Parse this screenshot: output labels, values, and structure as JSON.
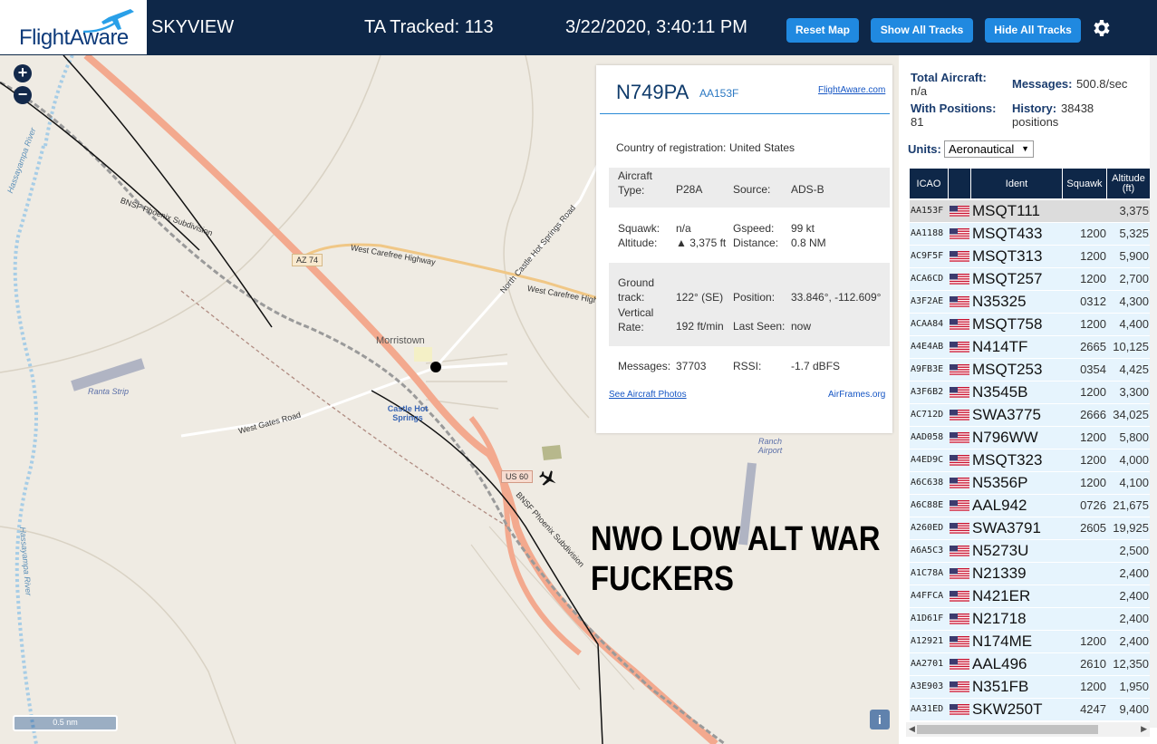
{
  "header": {
    "logo_text": "FlightAware",
    "site": "SKYVIEW",
    "tracked": "TA Tracked: 113",
    "datetime": "3/22/2020, 3:40:11 PM",
    "btn_reset": "Reset Map",
    "btn_show": "Show All Tracks",
    "btn_hide": "Hide All Tracks"
  },
  "map": {
    "labels": {
      "hassayampa_top": "Hassayampa River",
      "hassayampa_left": "Hassayampa River",
      "bnsf1": "BNSF Phoenix Subdivision",
      "bnsf2": "BNSF Phoenix Subdivision",
      "az74": "AZ 74",
      "carefree1": "West Carefree Highway",
      "carefree2": "West Carefree Highway",
      "castle_rd": "North Castle Hot Springs Road",
      "morristown": "Morristown",
      "castle_hs": "Castle Hot Springs",
      "west_gates": "West Gates Road",
      "ranta": "Ranta Strip",
      "ranch_airport": "Ranch Airport",
      "us60": "US 60",
      "scale": "0.5 nm",
      "info": "i"
    },
    "banner_line1": "NWO LOW ALT WAR",
    "banner_line2": "FUCKERS"
  },
  "popup": {
    "registration": "N749PA",
    "icao": "AA153F",
    "link_fa": "FlightAware.com",
    "country_label": "Country of registration:",
    "country": "United States",
    "type_label": "Aircraft Type:",
    "type": "P28A",
    "source_label": "Source:",
    "source": "ADS-B",
    "squawk_label": "Squawk:",
    "squawk": "n/a",
    "gspeed_label": "Gspeed:",
    "gspeed": "99 kt",
    "altitude_label": "Altitude:",
    "altitude": "▲ 3,375 ft",
    "distance_label": "Distance:",
    "distance": "0.8 NM",
    "track_label": "Ground track:",
    "track": "122° (SE)",
    "position_label": "Position:",
    "position": "33.846°, -112.609°",
    "vrate_label": "Vertical Rate:",
    "vrate": "192 ft/min",
    "lastseen_label": "Last Seen:",
    "lastseen": "now",
    "messages_label": "Messages:",
    "messages": "37703",
    "rssi_label": "RSSI:",
    "rssi": "-1.7 dBFS",
    "photos_link": "See Aircraft Photos",
    "airframes_link": "AirFrames.org"
  },
  "sidebar": {
    "total_label": "Total Aircraft:",
    "total": "n/a",
    "messages_label": "Messages:",
    "messages": "500.8/sec",
    "withpos_label": "With Positions:",
    "withpos": "81",
    "history_label": "History:",
    "history": "38438 positions",
    "units_label": "Units:",
    "units": "Aeronautical"
  },
  "table": {
    "headers": [
      "ICAO",
      "Ident",
      "Squawk",
      "Altitude (ft)"
    ],
    "rows": [
      {
        "icao": "AA153F",
        "ident": "MSQT111",
        "squawk": "",
        "alt": "3,375"
      },
      {
        "icao": "AA1188",
        "ident": "MSQT433",
        "squawk": "1200",
        "alt": "5,325"
      },
      {
        "icao": "AC9F5F",
        "ident": "MSQT313",
        "squawk": "1200",
        "alt": "5,900"
      },
      {
        "icao": "ACA6CD",
        "ident": "MSQT257",
        "squawk": "1200",
        "alt": "2,700"
      },
      {
        "icao": "A3F2AE",
        "ident": "N35325",
        "squawk": "0312",
        "alt": "4,300"
      },
      {
        "icao": "ACAA84",
        "ident": "MSQT758",
        "squawk": "1200",
        "alt": "4,400"
      },
      {
        "icao": "A4E4AB",
        "ident": "N414TF",
        "squawk": "2665",
        "alt": "10,125"
      },
      {
        "icao": "A9FB3E",
        "ident": "MSQT253",
        "squawk": "0354",
        "alt": "4,425"
      },
      {
        "icao": "A3F6B2",
        "ident": "N3545B",
        "squawk": "1200",
        "alt": "3,300"
      },
      {
        "icao": "AC712D",
        "ident": "SWA3775",
        "squawk": "2666",
        "alt": "34,025"
      },
      {
        "icao": "AAD058",
        "ident": "N796WW",
        "squawk": "1200",
        "alt": "5,800"
      },
      {
        "icao": "A4ED9C",
        "ident": "MSQT323",
        "squawk": "1200",
        "alt": "4,000"
      },
      {
        "icao": "A6C638",
        "ident": "N5356P",
        "squawk": "1200",
        "alt": "4,100"
      },
      {
        "icao": "A6C88E",
        "ident": "AAL942",
        "squawk": "0726",
        "alt": "21,675"
      },
      {
        "icao": "A260ED",
        "ident": "SWA3791",
        "squawk": "2605",
        "alt": "19,925"
      },
      {
        "icao": "A6A5C3",
        "ident": "N5273U",
        "squawk": "",
        "alt": "2,500"
      },
      {
        "icao": "A1C78A",
        "ident": "N21339",
        "squawk": "",
        "alt": "2,400"
      },
      {
        "icao": "A4FFCA",
        "ident": "N421ER",
        "squawk": "",
        "alt": "2,400"
      },
      {
        "icao": "A1D61F",
        "ident": "N21718",
        "squawk": "",
        "alt": "2,400"
      },
      {
        "icao": "A12921",
        "ident": "N174ME",
        "squawk": "1200",
        "alt": "2,400"
      },
      {
        "icao": "AA2701",
        "ident": "AAL496",
        "squawk": "2610",
        "alt": "12,350"
      },
      {
        "icao": "A3E903",
        "ident": "N351FB",
        "squawk": "1200",
        "alt": "1,950"
      },
      {
        "icao": "AA31ED",
        "ident": "SKW250T",
        "squawk": "4247",
        "alt": "9,400"
      }
    ]
  },
  "colors": {
    "header_bg": "#0e2748",
    "button": "#2089e0",
    "row_bg": "#e6f4fd",
    "row_selected": "#dcdcdc",
    "map_bg": "#efebe3"
  }
}
